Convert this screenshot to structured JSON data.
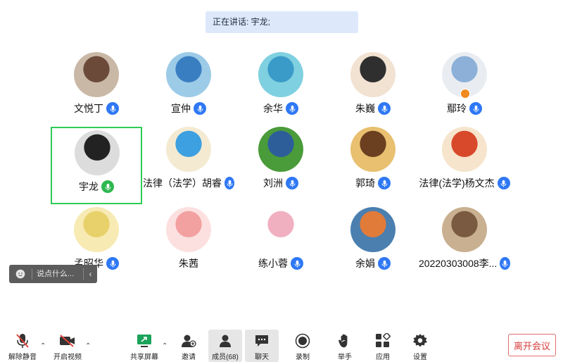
{
  "speaking": {
    "text": "正在讲话: 宇龙;"
  },
  "participants": [
    {
      "name": "文悦丁",
      "mic": "blue",
      "avatar_color": "#6b4a3a",
      "bg": "#c9b8a6"
    },
    {
      "name": "宣仲",
      "mic": "blue",
      "avatar_color": "#3a7ec2",
      "bg": "#9ccbe8"
    },
    {
      "name": "余华",
      "mic": "blue",
      "avatar_color": "#3a9bc8",
      "bg": "#7fd0e0"
    },
    {
      "name": "朱巍",
      "mic": "blue",
      "avatar_color": "#2f2f2f",
      "bg": "#f2e2d2"
    },
    {
      "name": "鄢玲",
      "mic": "blue",
      "avatar_color": "#8cb0d8",
      "bg": "#e9edf2",
      "host": true
    },
    {
      "name": "宇龙",
      "mic": "green",
      "avatar_color": "#222",
      "bg": "#dcdcdc",
      "active": true
    },
    {
      "name": "法律（法学）胡睿",
      "mic": "blue",
      "avatar_color": "#3da0e0",
      "bg": "#f4ead2"
    },
    {
      "name": "刘洲",
      "mic": "blue",
      "avatar_color": "#2d5e9a",
      "bg": "#4a9b3a"
    },
    {
      "name": "郭琦",
      "mic": "blue",
      "avatar_color": "#6b4020",
      "bg": "#e8c070"
    },
    {
      "name": "法律(法学)杨文杰",
      "mic": "blue",
      "avatar_color": "#d8492b",
      "bg": "#f6e4cc"
    },
    {
      "name": "孟昭华",
      "mic": "blue",
      "avatar_color": "#e8d16a",
      "bg": "#f7eab3"
    },
    {
      "name": "朱茜",
      "mic": "none",
      "avatar_color": "#f2a0a0",
      "bg": "#fce0e0"
    },
    {
      "name": "练小蓉",
      "mic": "blue",
      "avatar_color": "#f0b0c0",
      "bg": "#ffffff"
    },
    {
      "name": "余娟",
      "mic": "blue",
      "avatar_color": "#e07b3a",
      "bg": "#4a7fb0"
    },
    {
      "name": "20220303008李...",
      "mic": "blue",
      "avatar_color": "#7a5a40",
      "bg": "#c8b090"
    }
  ],
  "chat_input": {
    "placeholder": "说点什么..."
  },
  "toolbar": {
    "unmute": "解除静音",
    "video": "开启视频",
    "share": "共享屏幕",
    "invite": "邀请",
    "members": "成员(68)",
    "chat": "聊天",
    "record": "录制",
    "raise_hand": "举手",
    "apps": "应用",
    "settings": "设置",
    "leave": "离开会议"
  }
}
